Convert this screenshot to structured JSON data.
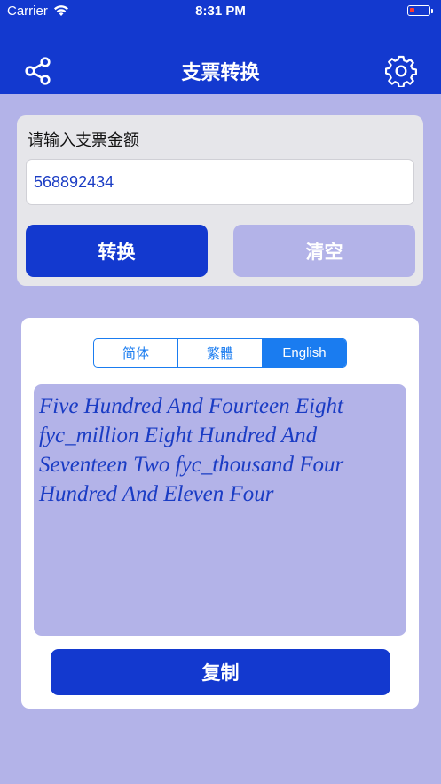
{
  "status_bar": {
    "carrier": "Carrier",
    "time": "8:31 PM"
  },
  "nav": {
    "title": "支票转换",
    "left_icon": "share-icon",
    "right_icon": "gear-icon"
  },
  "input_card": {
    "label": "请输入支票金额",
    "amount_value": "568892434",
    "convert_label": "转换",
    "clear_label": "清空"
  },
  "result_card": {
    "segments": [
      "简体",
      "繁體",
      "English"
    ],
    "selected_segment": "English",
    "result_text": "Five Hundred And Fourteen Eight fyc_million Eight Hundred And Seventeen Two fyc_thousand Four Hundred And Eleven Four",
    "copy_label": "复制"
  },
  "colors": {
    "primary": "#1339cf",
    "background": "#b3b3e8",
    "segment_accent": "#1a7cf0",
    "battery_low": "#ff3b30"
  }
}
